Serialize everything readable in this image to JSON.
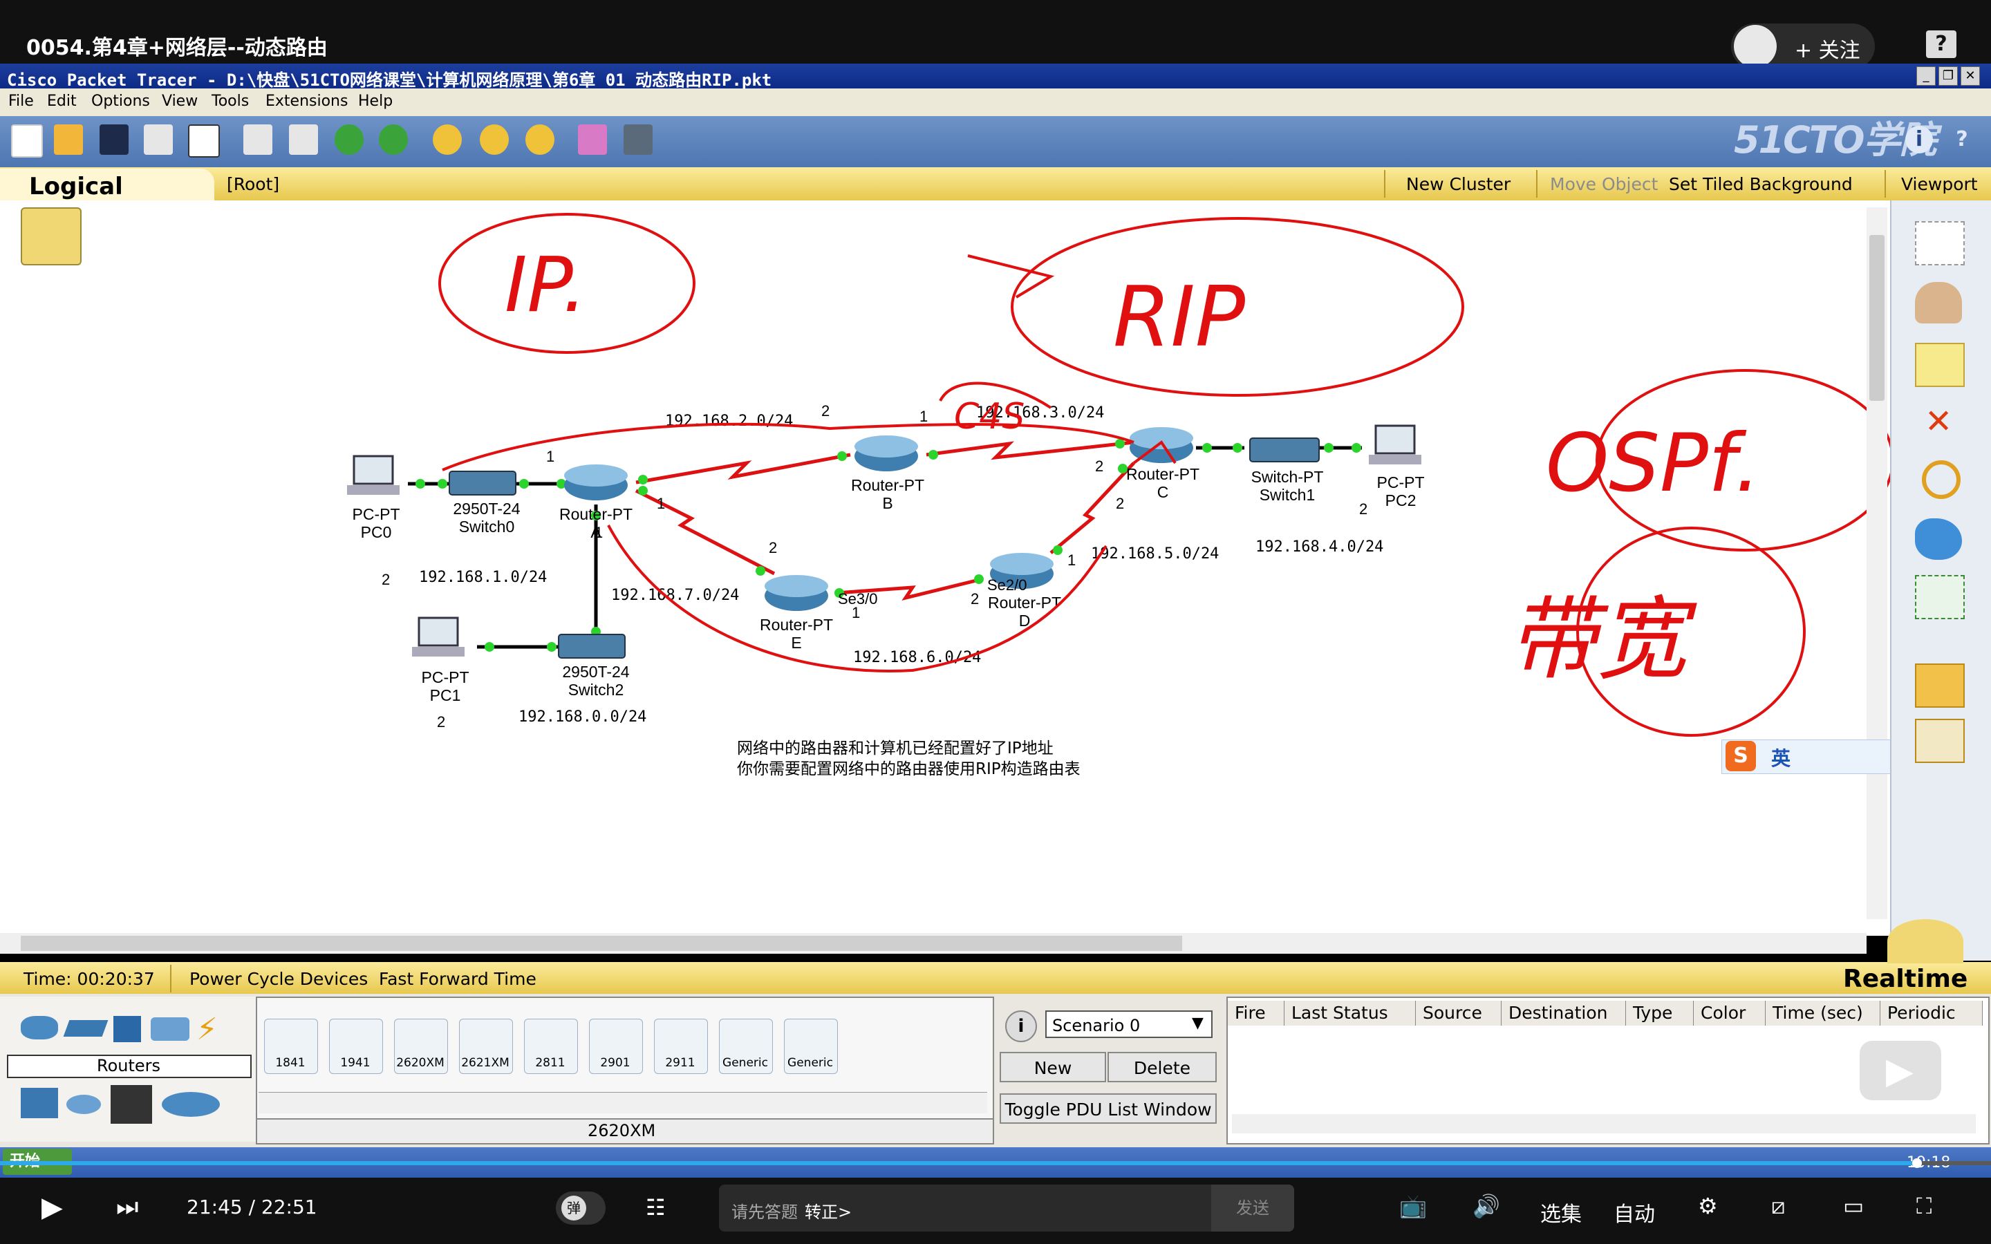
{
  "video": {
    "title": "0054.第4章+网络层--动态路由",
    "follow_label": "+ 关注",
    "help_label": "?",
    "current_time": "21:45",
    "duration": "22:51",
    "time_display": "21:45  /  22:51",
    "progress_fraction": 0.963,
    "danmu_label": "弹",
    "danmu_placeholder": "请先答题",
    "danmu_action": "转正>",
    "send_label": "发送",
    "episodes_label": "选集",
    "quality_label": "自动"
  },
  "pt": {
    "window_title": "Cisco Packet Tracer - D:\\快盘\\51CTO网络课堂\\计算机网络原理\\第6章 01 动态路由RIP.pkt",
    "menu": [
      "File",
      "Edit",
      "Options",
      "View",
      "Tools",
      "Extensions",
      "Help"
    ],
    "brand": "51CTO学院",
    "logical_label": "Logical",
    "root_label": "[Root]",
    "new_cluster": "New Cluster",
    "move_object": "Move Object",
    "set_tiled_bg": "Set Tiled Background",
    "viewport": "Viewport",
    "time_label": "Time: 00:20:37",
    "power_cycle": "Power Cycle Devices",
    "fast_forward": "Fast Forward Time",
    "realtime": "Realtime",
    "category_label": "Routers",
    "models": [
      "1841",
      "1941",
      "2620XM",
      "2621XM",
      "2811",
      "2901",
      "2911",
      "Generic",
      "Generic"
    ],
    "selected_model": "2620XM",
    "scenario": "Scenario 0",
    "new_label": "New",
    "delete_label": "Delete",
    "toggle_pdu": "Toggle PDU List Window",
    "pdu_headers": [
      "Fire",
      "Last Status",
      "Source",
      "Destination",
      "Type",
      "Color",
      "Time (sec)",
      "Periodic"
    ],
    "start_label": "开始",
    "clock": "19:18",
    "ime_label": "英"
  },
  "topology": {
    "devices": {
      "pc0": [
        "PC-PT",
        "PC0"
      ],
      "switch0": [
        "2950T-24",
        "Switch0"
      ],
      "router_a": [
        "Router-PT",
        "A"
      ],
      "router_b": [
        "Router-PT",
        "B"
      ],
      "router_c": [
        "Router-PT",
        "C"
      ],
      "switch1": [
        "Switch-PT",
        "Switch1"
      ],
      "pc2": [
        "PC-PT",
        "PC2"
      ],
      "router_e": [
        "Router-PT",
        "E"
      ],
      "router_d": [
        "Router-PT",
        "D"
      ],
      "pc1": [
        "PC-PT",
        "PC1"
      ],
      "switch2": [
        "2950T-24",
        "Switch2"
      ]
    },
    "networks": {
      "n1": "192.168.1.0/24",
      "n2": "192.168.2.0/24",
      "n3": "192.168.3.0/24",
      "n5": "192.168.5.0/24",
      "n4": "192.168.4.0/24",
      "n7": "192.168.7.0/24",
      "n6": "192.168.6.0/24",
      "n0": "192.168.0.0/24"
    },
    "interfaces": {
      "se30": "Se3/0",
      "se20": "Se2/0"
    },
    "port_numbers": {
      "p1": "1",
      "p2": "2",
      "p3": "1",
      "p4": "2",
      "p5": "1",
      "p6": "2",
      "p7": "1",
      "p8": "2",
      "p9": "1",
      "p10": "2",
      "p11": "2",
      "p12": "2",
      "p13": "1",
      "p14": "2"
    },
    "note_line1": "网络中的路由器和计算机已经配置好了IP地址",
    "note_line2": "你你需要配置网络中的路由器使用RIP构造路由表"
  },
  "annotations": {
    "ip": "IP.",
    "rip": "RIP",
    "rip_sub": "C4S",
    "ospf": "OSPf.",
    "bandwidth": "带宽"
  }
}
